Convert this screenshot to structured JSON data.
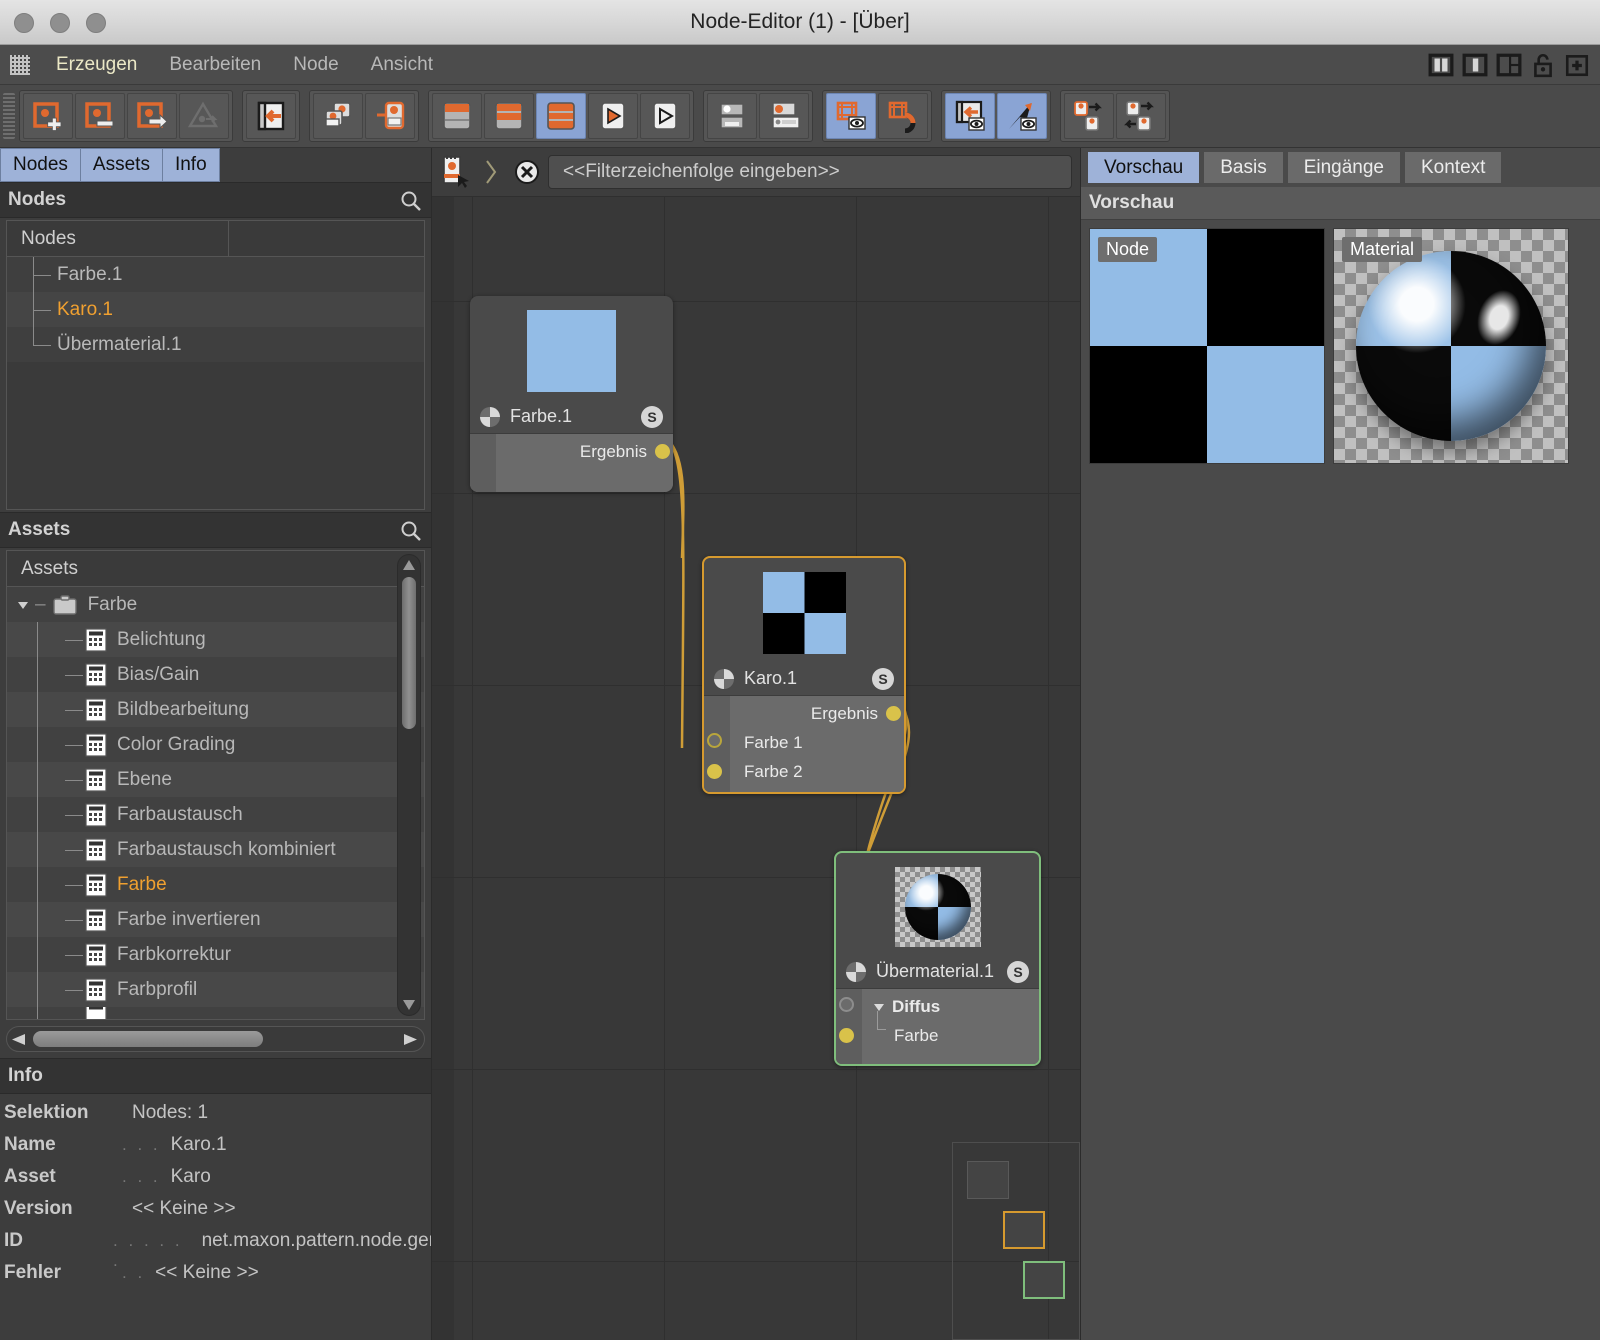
{
  "window": {
    "title": "Node-Editor (1) - [Über]"
  },
  "menubar": {
    "items": [
      "Erzeugen",
      "Bearbeiten",
      "Node",
      "Ansicht"
    ],
    "right_icons": [
      "layout-split-icon",
      "layout-split-2-icon",
      "layout-grid-icon",
      "unlock-icon",
      "plus-icon"
    ]
  },
  "toolbar": {
    "groups": [
      {
        "buttons": [
          {
            "name": "add-node-button",
            "icon": "node-plus-icon",
            "active": false
          },
          {
            "name": "remove-node-button",
            "icon": "node-minus-icon",
            "active": false
          },
          {
            "name": "node-arrow-button",
            "icon": "node-arrow-icon",
            "active": false
          },
          {
            "name": "triangle-button",
            "icon": "triangle-node-icon",
            "active": false
          }
        ]
      },
      {
        "buttons": [
          {
            "name": "collapse-left-button",
            "icon": "page-arrow-left-icon",
            "active": false
          }
        ]
      },
      {
        "buttons": [
          {
            "name": "group-nodes-button",
            "icon": "stacked-nodes-icon",
            "active": false
          },
          {
            "name": "ungroup-nodes-button",
            "icon": "detach-node-icon",
            "active": false
          }
        ]
      },
      {
        "buttons": [
          {
            "name": "detail-small-button",
            "icon": "rows-small-icon",
            "active": false
          },
          {
            "name": "detail-medium-button",
            "icon": "rows-medium-icon",
            "active": false
          },
          {
            "name": "detail-full-button",
            "icon": "rows-full-icon",
            "active": true
          },
          {
            "name": "play-orange-button",
            "icon": "play-orange-icon",
            "active": false
          },
          {
            "name": "play-dark-button",
            "icon": "play-dark-icon",
            "active": false
          }
        ]
      },
      {
        "buttons": [
          {
            "name": "port-circle-button",
            "icon": "port-white-icon",
            "active": false
          },
          {
            "name": "port-orange-button",
            "icon": "port-orange-icon",
            "active": false
          }
        ]
      },
      {
        "buttons": [
          {
            "name": "show-frame-button",
            "icon": "frame-eye-icon",
            "active": true
          },
          {
            "name": "snap-button",
            "icon": "frame-magnet-icon",
            "active": false
          }
        ]
      },
      {
        "buttons": [
          {
            "name": "show-page-button",
            "icon": "page-arrow-eye-icon",
            "active": true
          },
          {
            "name": "show-cursor-button",
            "icon": "cursor-eye-icon",
            "active": true
          }
        ]
      },
      {
        "buttons": [
          {
            "name": "connect-forward-button",
            "icon": "node-arrow-right-icon",
            "active": false
          },
          {
            "name": "connect-both-button",
            "icon": "node-arrows-both-icon",
            "active": false
          }
        ]
      }
    ]
  },
  "left_panel": {
    "tabs": [
      {
        "label": "Nodes",
        "active": true
      },
      {
        "label": "Assets",
        "active": true
      },
      {
        "label": "Info",
        "active": true
      }
    ],
    "nodes_section": {
      "title": "Nodes",
      "column_header": "Nodes",
      "rows": [
        {
          "label": "Farbe.1",
          "selected": false
        },
        {
          "label": "Karo.1",
          "selected": true
        },
        {
          "label": "Übermaterial.1",
          "selected": false
        }
      ]
    },
    "assets_section": {
      "title": "Assets",
      "column_header": "Assets",
      "root": "Farbe",
      "items": [
        {
          "label": "Belichtung",
          "selected": false
        },
        {
          "label": "Bias/Gain",
          "selected": false
        },
        {
          "label": "Bildbearbeitung",
          "selected": false
        },
        {
          "label": "Color Grading",
          "selected": false
        },
        {
          "label": "Ebene",
          "selected": false
        },
        {
          "label": "Farbaustausch",
          "selected": false
        },
        {
          "label": "Farbaustausch kombiniert",
          "selected": false
        },
        {
          "label": "Farbe",
          "selected": true
        },
        {
          "label": "Farbe invertieren",
          "selected": false
        },
        {
          "label": "Farbkorrektur",
          "selected": false
        },
        {
          "label": "Farbprofil",
          "selected": false
        }
      ]
    },
    "info_section": {
      "title": "Info",
      "rows": [
        {
          "key": "Selektion",
          "dots": "",
          "value": "Nodes: 1"
        },
        {
          "key": "Name",
          "dots": ". . .",
          "value": "Karo.1"
        },
        {
          "key": "Asset",
          "dots": ". . .",
          "value": "Karo"
        },
        {
          "key": "Version",
          "dots": "",
          "value": "<< Keine >>"
        },
        {
          "key": "ID",
          "dots": ". . . . . .",
          "value": "net.maxon.pattern.node.gene"
        },
        {
          "key": "Fehler",
          "dots": ". .",
          "value": "<< Keine >>"
        }
      ]
    }
  },
  "editor": {
    "filter_placeholder": "<<Filterzeichenfolge eingeben>>",
    "nodes": [
      {
        "name": "Farbe.1",
        "badge": "S",
        "selection": "none",
        "outputs": [
          "Ergebnis"
        ],
        "inputs": []
      },
      {
        "name": "Karo.1",
        "badge": "S",
        "selection": "orange",
        "outputs": [
          "Ergebnis"
        ],
        "inputs": [
          "Farbe 1",
          "Farbe 2"
        ]
      },
      {
        "name": "Übermaterial.1",
        "badge": "S",
        "selection": "green",
        "outputs": [],
        "inputs": [
          "Diffus",
          "Farbe"
        ]
      }
    ]
  },
  "right_panel": {
    "tabs": [
      {
        "label": "Vorschau",
        "active": true
      },
      {
        "label": "Basis",
        "active": false
      },
      {
        "label": "Eingänge",
        "active": false
      },
      {
        "label": "Kontext",
        "active": false
      }
    ],
    "section_title": "Vorschau",
    "previews": [
      {
        "label": "Node"
      },
      {
        "label": "Material"
      }
    ]
  },
  "colors": {
    "accent_orange": "#f0a030",
    "tab_blue": "#9eb2d8",
    "node_blue": "#93bce6",
    "wire_yellow": "#d4a03c",
    "select_green": "#7fbe7c",
    "port_yellow": "#d9c24a"
  }
}
